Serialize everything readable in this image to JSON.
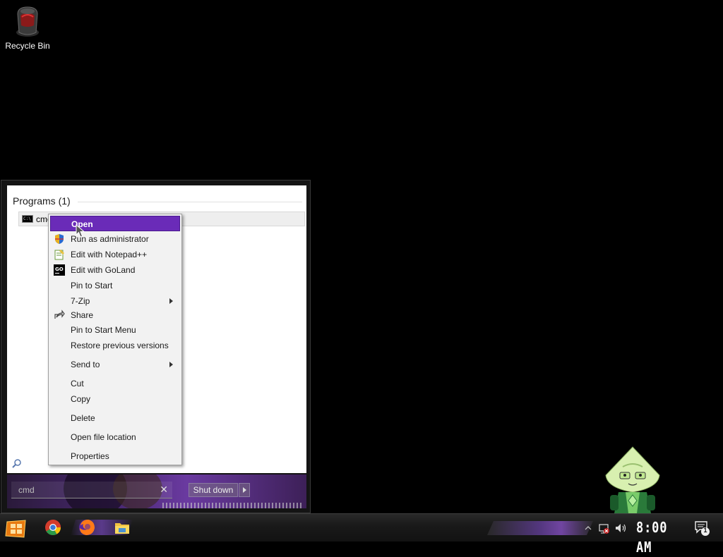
{
  "desktop": {
    "recycle_bin_label": "Recycle Bin"
  },
  "start_menu": {
    "programs_header": "Programs (1)",
    "results": [
      {
        "label": "cmd",
        "icon": "command-prompt-icon"
      }
    ],
    "search": {
      "value": "cmd",
      "clear_glyph": "✕"
    },
    "shutdown_label": "Shut down"
  },
  "context_menu": {
    "items": [
      {
        "label": "Open",
        "selected": true
      },
      {
        "label": "Run as administrator",
        "icon": "uac-shield-icon"
      },
      {
        "label": "Edit with Notepad++",
        "icon": "notepad-plus-plus-icon"
      },
      {
        "label": "Edit with GoLand",
        "icon": "goland-icon"
      },
      {
        "label": "Pin to Start"
      },
      {
        "label": "7-Zip",
        "submenu": true
      },
      {
        "label": "Share",
        "icon": "share-icon"
      },
      {
        "label": "Pin to Start Menu"
      },
      {
        "label": "Restore previous versions"
      },
      {
        "label": "Send to",
        "submenu": true
      },
      {
        "label": "Cut"
      },
      {
        "label": "Copy"
      },
      {
        "label": "Delete"
      },
      {
        "label": "Open file location"
      },
      {
        "label": "Properties"
      }
    ]
  },
  "taskbar": {
    "apps": [
      "chrome-icon",
      "firefox-icon",
      "file-explorer-icon"
    ],
    "clock": "8:00 AM",
    "notification_count": "1"
  },
  "colors": {
    "menu_highlight": "#6a2bb8",
    "accent_purple": "#5a3a8a"
  }
}
